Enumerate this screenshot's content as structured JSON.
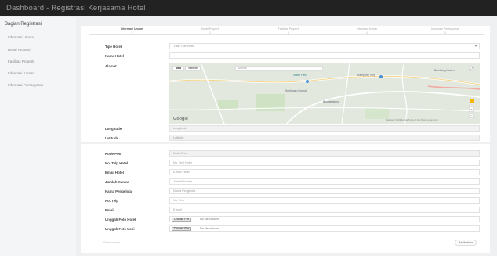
{
  "header": {
    "title": "Dashboard - Registrasi Kerjasama Hotel"
  },
  "sidebar": {
    "heading": "Bagian Registrasi",
    "items": [
      {
        "label": "Informasi Umum"
      },
      {
        "label": "Detail Properti"
      },
      {
        "label": "Fasilitas Properti"
      },
      {
        "label": "Informasi Kamar"
      },
      {
        "label": "Informasi Pembayaran"
      }
    ]
  },
  "steps": [
    {
      "label": "Informasi Umum",
      "num": "1"
    },
    {
      "label": "Detail Properti",
      "num": "2"
    },
    {
      "label": "Fasilitas Properti",
      "num": "3"
    },
    {
      "label": "Informasi Kamar",
      "num": "4"
    },
    {
      "label": "Informasi Pembayaran",
      "num": "5"
    }
  ],
  "form": {
    "tipe_hotel": {
      "label": "Tipe Hotel",
      "value": "-Pilih Tipe Hotel-"
    },
    "nama_hotel": {
      "label": "Nama Hotel",
      "value": ""
    },
    "alamat": {
      "label": "Alamat"
    },
    "map": {
      "btn_map": "Map",
      "btn_satellite": "Satelite",
      "search_placeholder": "Alamat",
      "place_1": "Kampung Tulip",
      "place_2": "Water Park",
      "place_3": "Sudirman Ground",
      "place_4": "Boulderalpina",
      "place_5": "Bambang Lauten",
      "attribution": "Map data ©2019 Google   Terms of Use   Report a map error",
      "google": "Google"
    },
    "longitude": {
      "label": "Longitude",
      "value": "Longitude"
    },
    "latitude": {
      "label": "Latitude",
      "value": "Latitude"
    },
    "kode_pos": {
      "label": "Kode Pos",
      "placeholder": "Kode Pos"
    },
    "no_telp_hotel": {
      "label": "No. Telp Hotel",
      "placeholder": "No. Telp Hotel"
    },
    "email_hotel": {
      "label": "Email Hotel",
      "placeholder": "E-mail Hotel"
    },
    "jumlah_kamar": {
      "label": "Jumlah Kamar",
      "placeholder": "Jumlah Kamar"
    },
    "nama_pengelola": {
      "label": "Nama Pengelola",
      "placeholder": "Nama Pengelola"
    },
    "no_telp": {
      "label": "No. Telp",
      "placeholder": "No. Telp"
    },
    "email": {
      "label": "Email",
      "placeholder": "E-mail"
    },
    "foto_hotel": {
      "label": "Unggah Foto Hotel",
      "button": "Choose File",
      "status": "No file chosen"
    },
    "foto_lobi": {
      "label": "Unggah Foto Lobi",
      "button": "Choose File",
      "status": "No file chosen"
    }
  },
  "nav": {
    "prev": "Sebelumnya",
    "next": "Berikutnya"
  }
}
